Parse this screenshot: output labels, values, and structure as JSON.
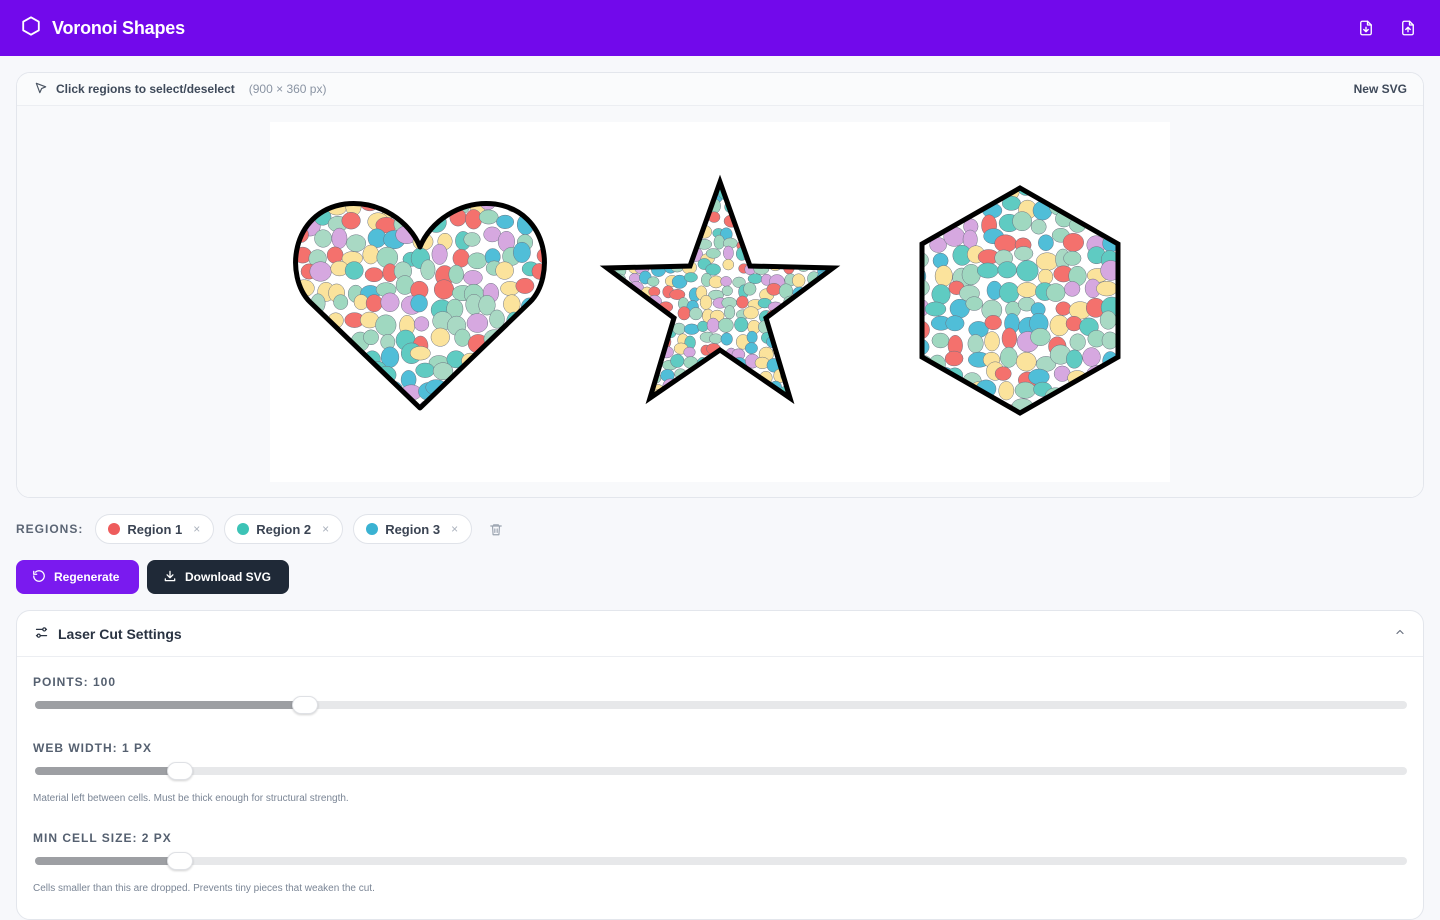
{
  "header": {
    "title": "Voronoi Shapes",
    "import_icon": "file-download-icon",
    "export_icon": "file-upload-icon"
  },
  "canvas": {
    "hint": "Click regions to select/deselect",
    "dimensions": "(900 × 360 px)",
    "new_svg_label": "New SVG",
    "shapes": [
      "heart",
      "star",
      "hexagon"
    ],
    "cell_colors": [
      "#f4716d",
      "#5fcbc2",
      "#9fd8c0",
      "#fbe39c",
      "#d6a8e0",
      "#50bed8",
      "#a9d9c4"
    ]
  },
  "regions": {
    "label": "REGIONS:",
    "items": [
      {
        "name": "Region 1",
        "color": "#ee5c5c"
      },
      {
        "name": "Region 2",
        "color": "#3cc3b6"
      },
      {
        "name": "Region 3",
        "color": "#3ab2d2"
      }
    ],
    "remove_glyph": "×"
  },
  "actions": {
    "regenerate": "Regenerate",
    "download": "Download SVG"
  },
  "settings": {
    "title": "Laser Cut Settings",
    "points": {
      "label": "POINTS: 100",
      "fraction": 0.197
    },
    "web_width": {
      "label": "WEB WIDTH: 1 PX",
      "fraction": 0.106,
      "help": "Material left between cells. Must be thick enough for structural strength."
    },
    "min_cell_size": {
      "label": "MIN CELL SIZE: 2 PX",
      "fraction": 0.106,
      "help": "Cells smaller than this are dropped. Prevents tiny pieces that weaken the cut."
    }
  },
  "colors": {
    "brand": "#7209eb",
    "primary_button": "#7a1aef",
    "dark_button": "#1f2937"
  }
}
